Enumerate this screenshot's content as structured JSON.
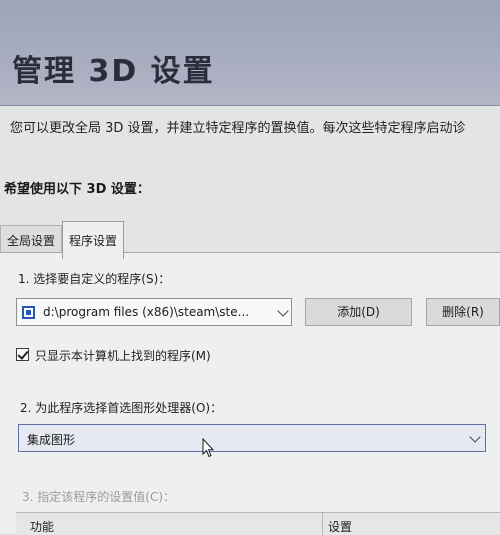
{
  "header": {
    "title": "管理 3D 设置"
  },
  "description": "您可以更改全局 3D 设置，并建立特定程序的置换值。每次这些特定程序启动诊",
  "section_heading": "希望使用以下 3D 设置：",
  "tabs": [
    {
      "label": "全局设置",
      "active": false
    },
    {
      "label": "程序设置",
      "active": true
    }
  ],
  "program_settings": {
    "step1_label": "1. 选择要自定义的程序(S)：",
    "program_select_value": "d:\\program files (x86)\\steam\\ste...",
    "add_button": "添加(D)",
    "remove_button": "删除(R)",
    "checkbox_label": "只显示本计算机上找到的程序(M)",
    "checkbox_checked": true,
    "step2_label": "2. 为此程序选择首选图形处理器(O)：",
    "gpu_select_value": "集成图形",
    "step3_label": "3. 指定该程序的设置值(C)：",
    "table_columns": [
      "功能",
      "设置"
    ]
  },
  "colors": {
    "header_bg": "#a9adc0",
    "panel_bg": "#eef0ef",
    "accent_border": "#5f6fa6",
    "program_icon": "#2856b8"
  },
  "icons": {
    "program": "program-icon",
    "dropdown": "chevron-down-icon",
    "cursor": "mouse-cursor-icon"
  }
}
